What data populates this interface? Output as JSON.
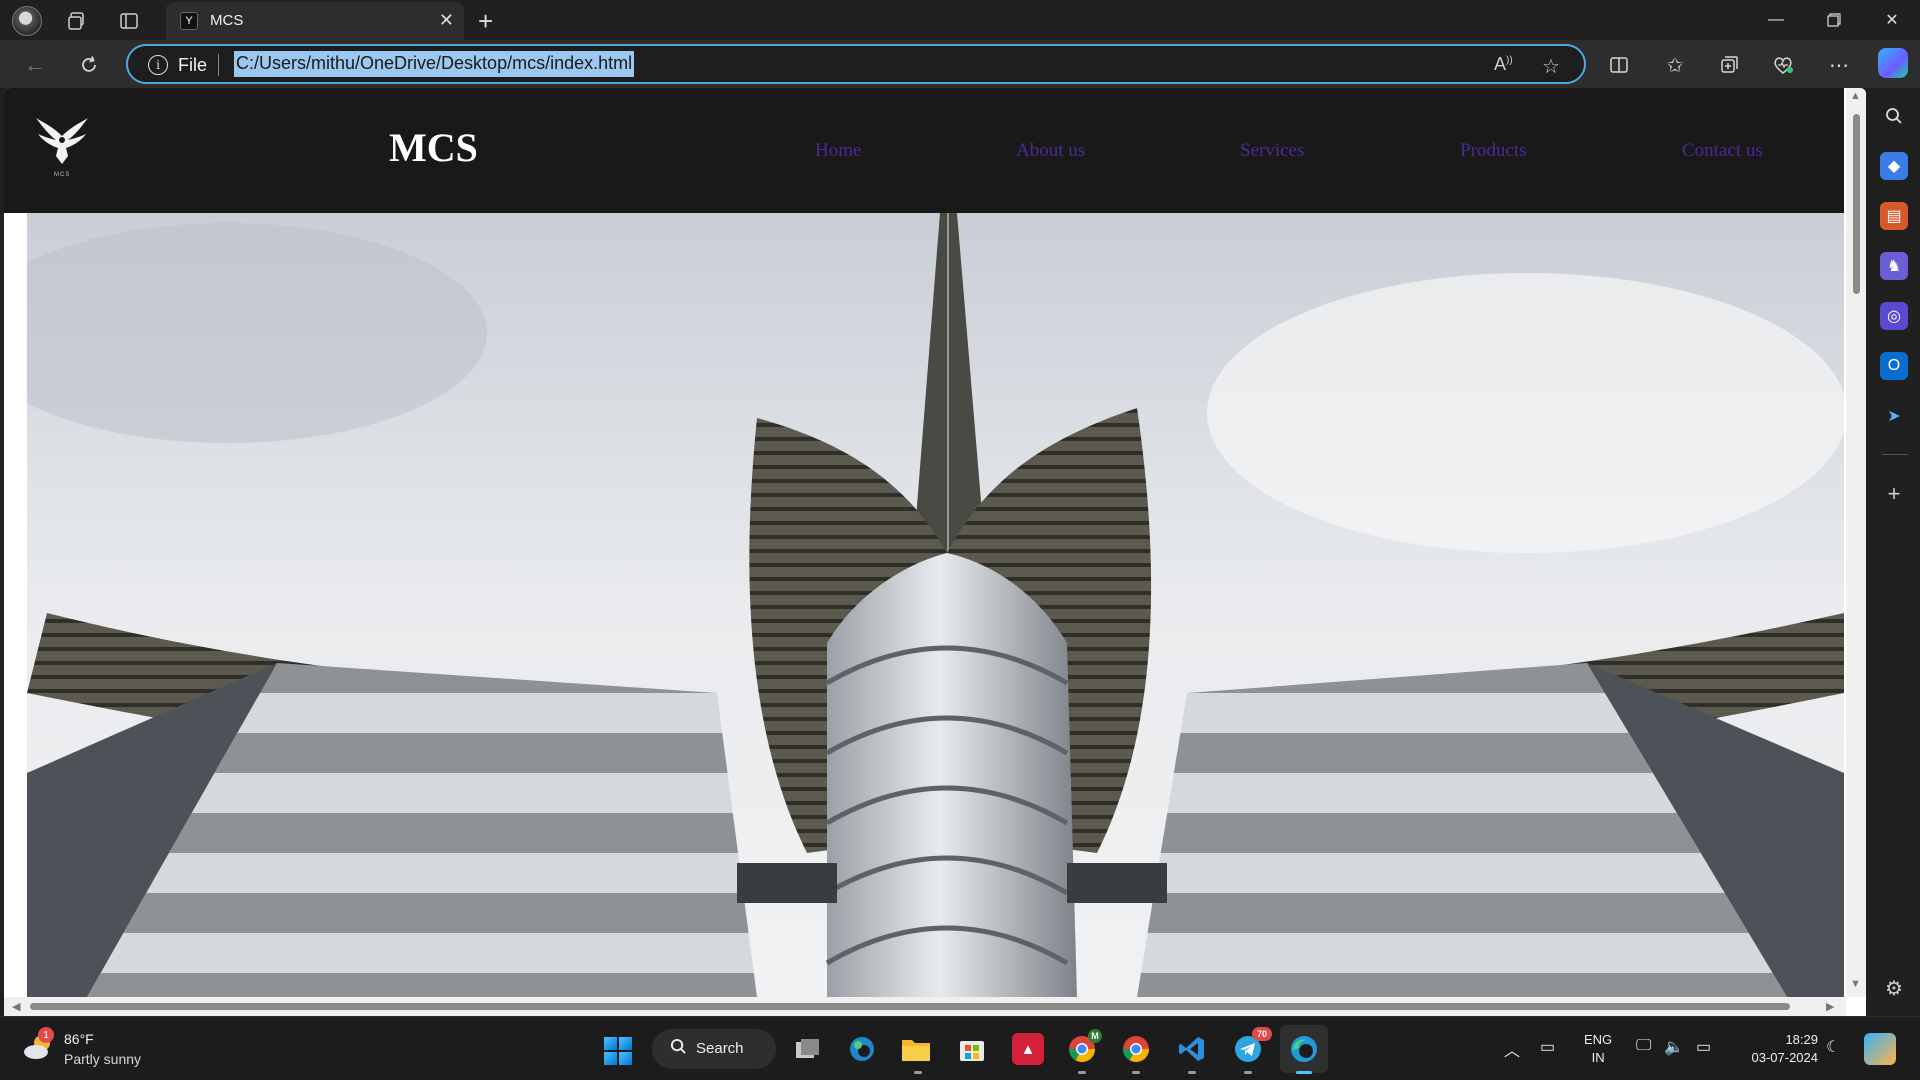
{
  "browser": {
    "tab_title": "MCS",
    "tab_favicon_letter": "Y",
    "address_scheme": "File",
    "address_url": "C:/Users/mithu/OneDrive/Desktop/mcs/index.html"
  },
  "site": {
    "logo_text": "MCS",
    "brand": "MCS",
    "nav": {
      "home": "Home",
      "about": "About us",
      "services": "Services",
      "products": "Products",
      "contact": "Contact us"
    },
    "nav_color": "#4a2a96",
    "header_bg": "#1a1919"
  },
  "taskbar": {
    "weather_badge": "1",
    "weather_temp": "86°F",
    "weather_desc": "Partly sunny",
    "search_label": "Search",
    "chrome_badge": "M",
    "telegram_badge": "70",
    "lang_line1": "ENG",
    "lang_line2": "IN",
    "time": "18:29",
    "date": "03-07-2024"
  }
}
